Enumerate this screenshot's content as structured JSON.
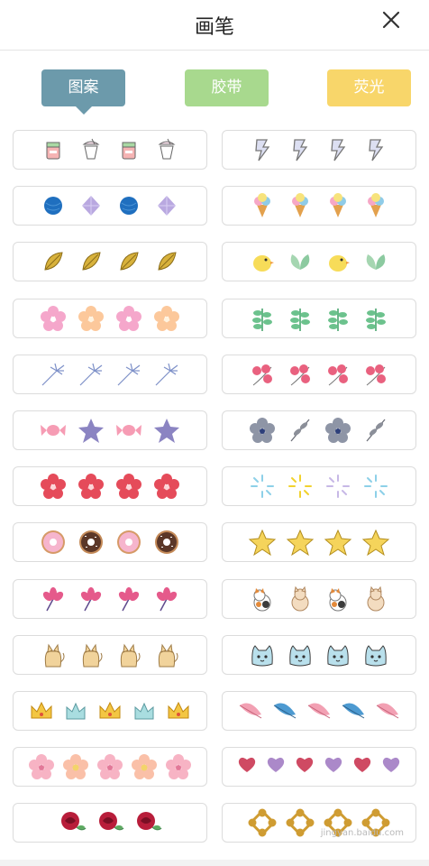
{
  "header": {
    "title": "画笔"
  },
  "tabs": [
    {
      "label": "图案",
      "color": "#6c9aab"
    },
    {
      "label": "胶带",
      "color": "#a8d98e"
    },
    {
      "label": "荧光",
      "color": "#f8d66a"
    }
  ],
  "brushes": [
    {
      "name": "brush-cake-cups",
      "icons": [
        "cake",
        "cup",
        "cake",
        "cup"
      ]
    },
    {
      "name": "brush-lightning",
      "icons": [
        "bolt",
        "bolt",
        "bolt",
        "bolt"
      ]
    },
    {
      "name": "brush-yarn-diamond",
      "icons": [
        "yarn",
        "diamond",
        "yarn",
        "diamond"
      ]
    },
    {
      "name": "brush-ice-cream",
      "icons": [
        "icecream",
        "icecream",
        "icecream",
        "icecream"
      ]
    },
    {
      "name": "brush-gold-leaves",
      "icons": [
        "goldleaf",
        "goldleaf",
        "goldleaf",
        "goldleaf"
      ]
    },
    {
      "name": "brush-chick-leaves",
      "icons": [
        "chick",
        "greenleaf",
        "chick",
        "greenleaf"
      ]
    },
    {
      "name": "brush-pink-peach-flowers",
      "icons": [
        "pinkflower",
        "peachflower",
        "pinkflower",
        "peachflower"
      ]
    },
    {
      "name": "brush-green-sprigs",
      "icons": [
        "sprig",
        "sprig",
        "sprig",
        "sprig"
      ]
    },
    {
      "name": "brush-blue-sparklers",
      "icons": [
        "sparkler",
        "sparkler",
        "sparkler",
        "sparkler"
      ]
    },
    {
      "name": "brush-berries",
      "icons": [
        "berry",
        "berry",
        "berry",
        "berry"
      ]
    },
    {
      "name": "brush-candy-stars",
      "icons": [
        "candy",
        "star-purple",
        "candy",
        "star-purple"
      ]
    },
    {
      "name": "brush-grey-flowers",
      "icons": [
        "greyflower",
        "greyleaf",
        "greyflower",
        "greyleaf"
      ]
    },
    {
      "name": "brush-red-blossoms",
      "icons": [
        "redflower",
        "redflower",
        "redflower",
        "redflower"
      ]
    },
    {
      "name": "brush-bursts",
      "icons": [
        "burst-blue",
        "burst-yellow",
        "burst-purple",
        "burst-blue"
      ]
    },
    {
      "name": "brush-donuts",
      "icons": [
        "donut-pink",
        "donut-choc",
        "donut-pink",
        "donut-choc"
      ]
    },
    {
      "name": "brush-gold-stars",
      "icons": [
        "star-gold",
        "star-gold",
        "star-gold",
        "star-gold"
      ]
    },
    {
      "name": "brush-pink-blooms",
      "icons": [
        "bloom",
        "bloom",
        "bloom",
        "bloom"
      ]
    },
    {
      "name": "brush-cats",
      "icons": [
        "calico",
        "creamcat",
        "calico",
        "creamcat"
      ]
    },
    {
      "name": "brush-sitting-cats",
      "icons": [
        "sitcat",
        "sitcat",
        "sitcat",
        "sitcat"
      ]
    },
    {
      "name": "brush-blue-cat-faces",
      "icons": [
        "catface",
        "catface",
        "catface",
        "catface"
      ]
    },
    {
      "name": "brush-crowns",
      "icons": [
        "crown",
        "bluecrown",
        "crown",
        "bluecrown",
        "crown"
      ]
    },
    {
      "name": "brush-feathers",
      "icons": [
        "feather-pink",
        "feather-blue",
        "feather-pink",
        "feather-blue",
        "feather-pink"
      ]
    },
    {
      "name": "brush-sakura",
      "icons": [
        "sakura",
        "sakura2",
        "sakura",
        "sakura2",
        "sakura"
      ]
    },
    {
      "name": "brush-hearts",
      "icons": [
        "heart-red",
        "heart-purple",
        "heart-red",
        "heart-purple",
        "heart-red",
        "heart-purple"
      ]
    },
    {
      "name": "brush-roses",
      "icons": [
        "rose",
        "rose",
        "rose"
      ]
    },
    {
      "name": "brush-knots",
      "icons": [
        "knot",
        "knot",
        "knot",
        "knot"
      ]
    }
  ],
  "watermark": "jingyan.baidu.com"
}
